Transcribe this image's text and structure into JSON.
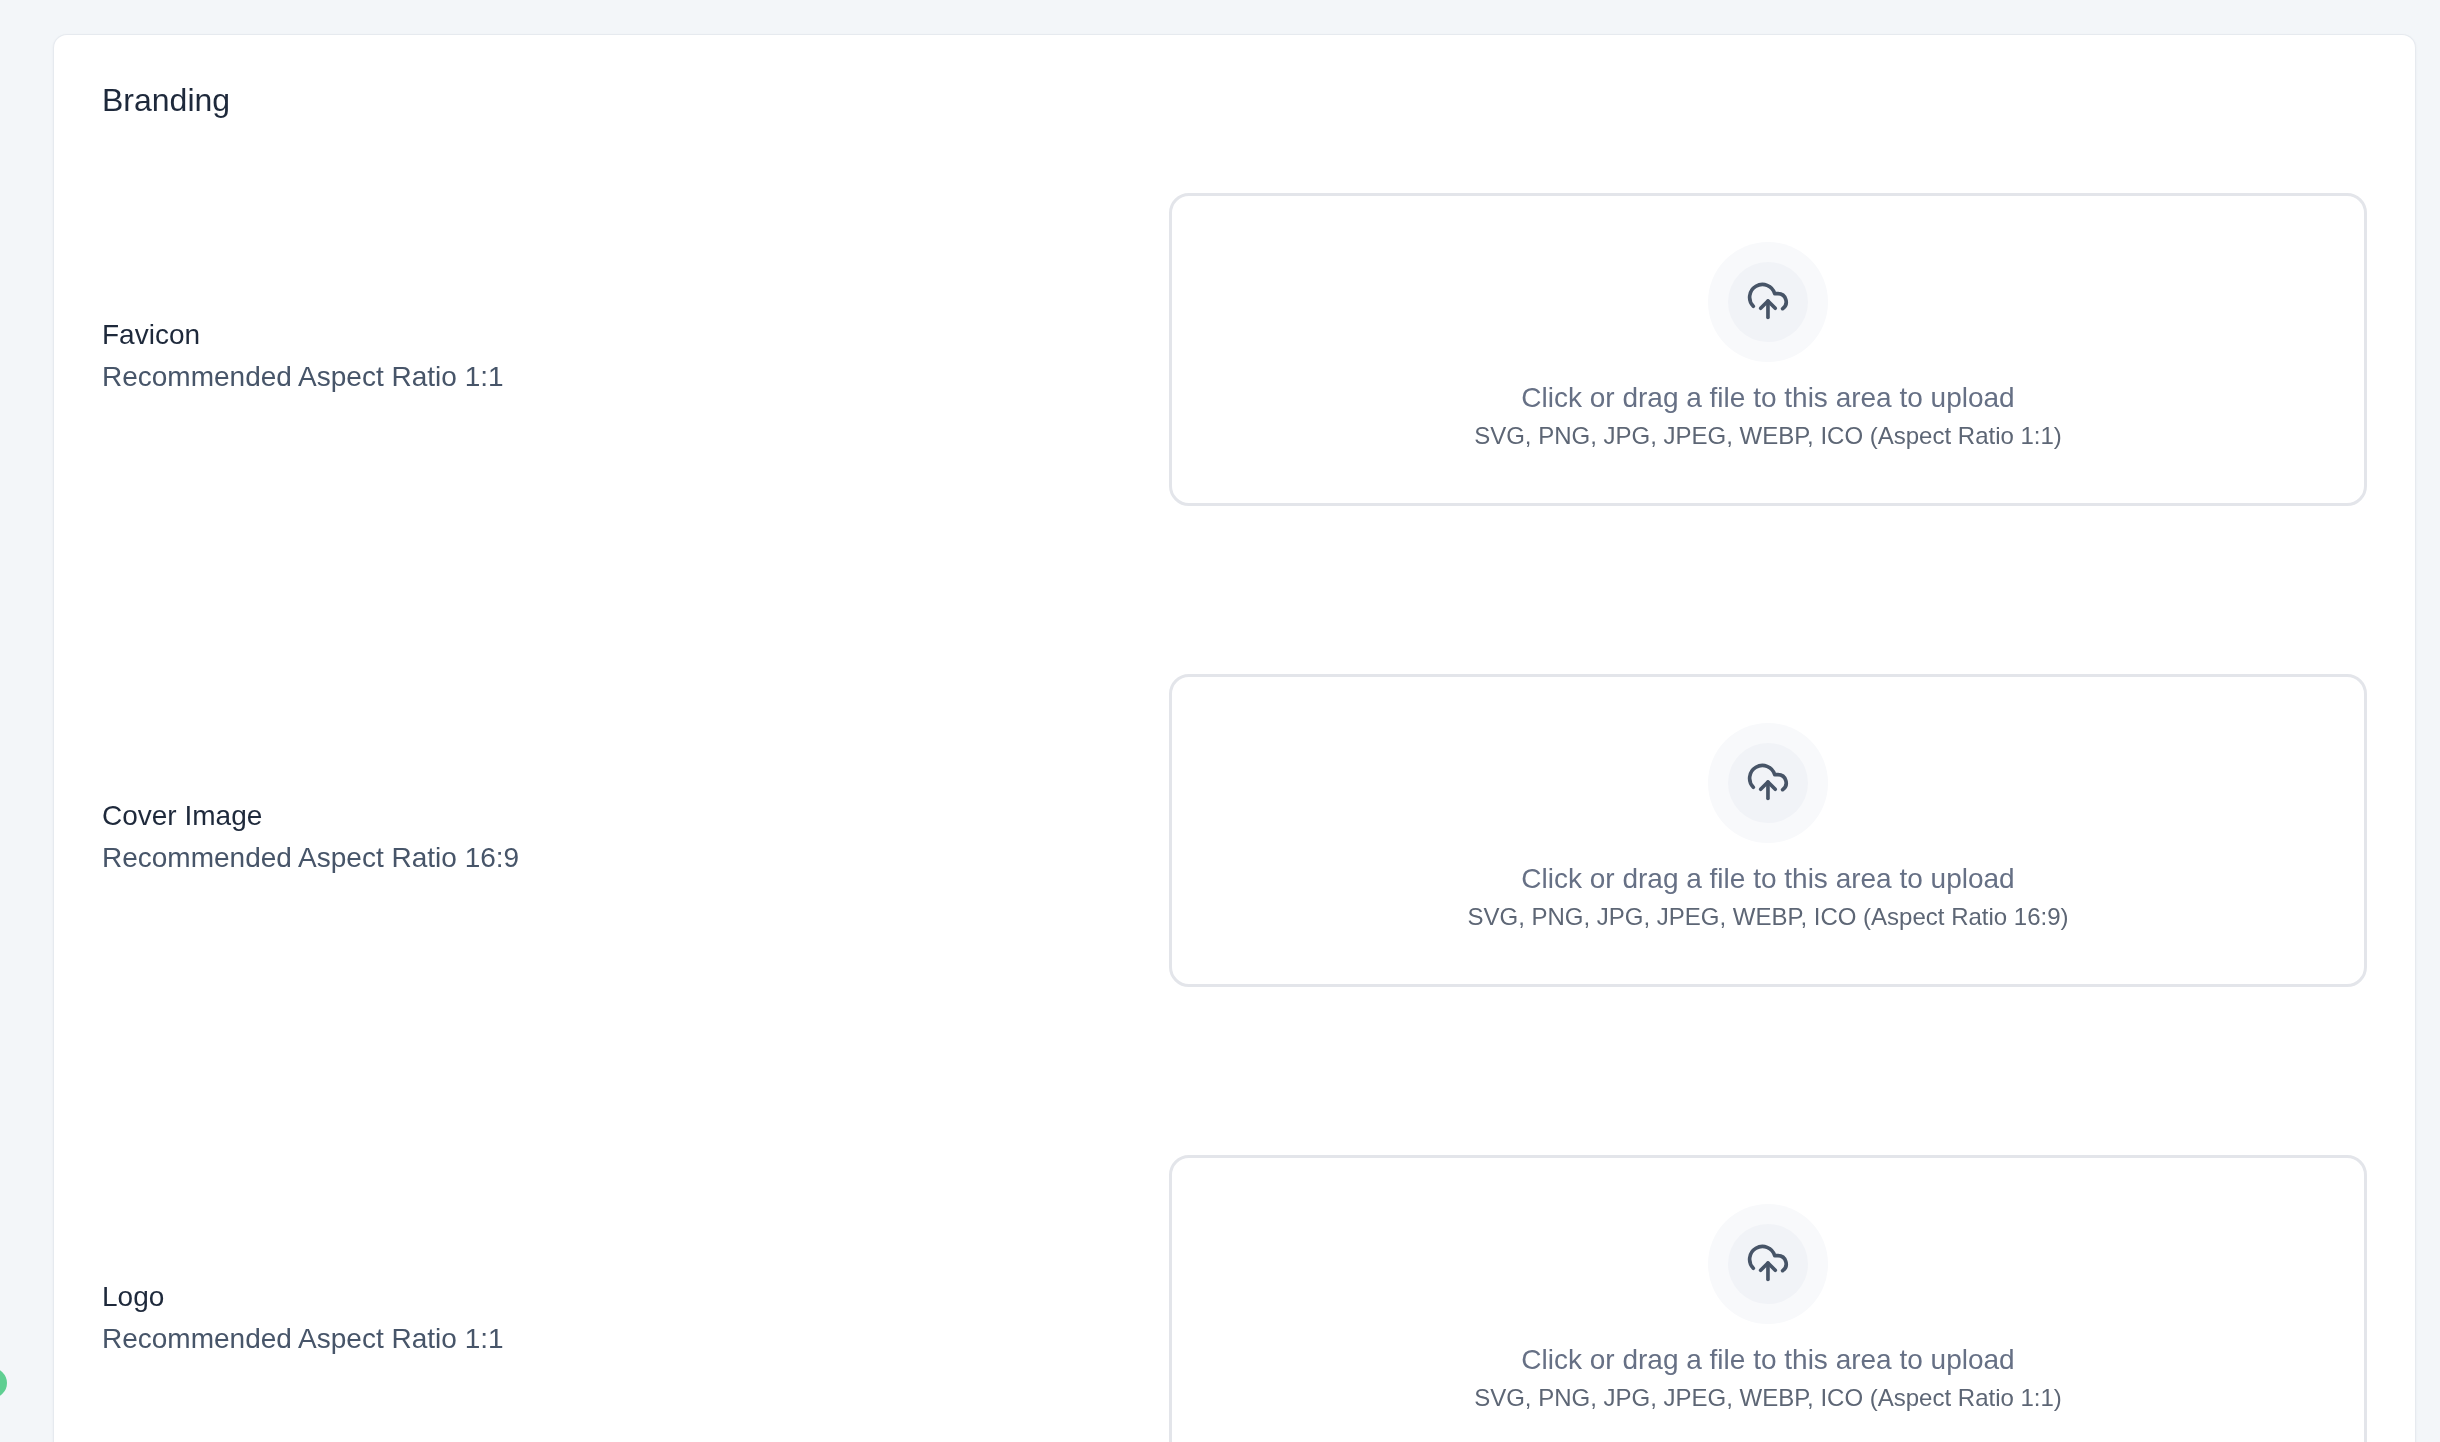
{
  "section": {
    "title": "Branding"
  },
  "uploads": [
    {
      "label": "Favicon",
      "hint": "Recommended Aspect Ratio 1:1",
      "prompt": "Click or drag a file to this area to upload",
      "formats": "SVG, PNG, JPG, JPEG, WEBP, ICO (Aspect Ratio 1:1)"
    },
    {
      "label": "Cover Image",
      "hint": "Recommended Aspect Ratio 16:9",
      "prompt": "Click or drag a file to this area to upload",
      "formats": "SVG, PNG, JPG, JPEG, WEBP, ICO (Aspect Ratio 16:9)"
    },
    {
      "label": "Logo",
      "hint": "Recommended Aspect Ratio 1:1",
      "prompt": "Click or drag a file to this area to upload",
      "formats": "SVG, PNG, JPG, JPEG, WEBP, ICO (Aspect Ratio 1:1)"
    }
  ]
}
